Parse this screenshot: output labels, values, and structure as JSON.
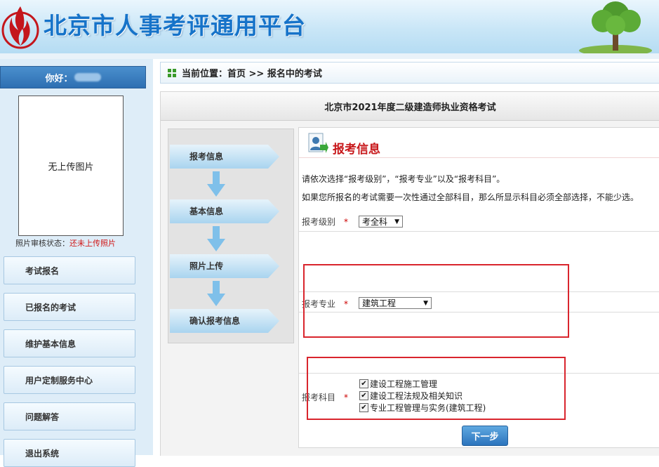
{
  "header": {
    "site_title": "北京市人事考评通用平台",
    "logo_icon": "flame-logo-icon",
    "decor_icon": "tree-icon"
  },
  "sidebar": {
    "greeting": "你好：",
    "photo_placeholder": "无上传图片",
    "photo_status_label": "照片审核状态：",
    "photo_status_value": "还未上传照片",
    "items": [
      {
        "label": "考试报名"
      },
      {
        "label": "已报名的考试"
      },
      {
        "label": "维护基本信息"
      },
      {
        "label": "用户定制服务中心"
      },
      {
        "label": "问题解答"
      },
      {
        "label": "退出系统"
      }
    ]
  },
  "breadcrumb": {
    "text": "当前位置：首页 >> 报名中的考试"
  },
  "exam": {
    "title": "北京市2021年度二级建造师执业资格考试"
  },
  "steps": [
    {
      "label": "报考信息"
    },
    {
      "label": "基本信息"
    },
    {
      "label": "照片上传"
    },
    {
      "label": "确认报考信息"
    }
  ],
  "form": {
    "section_title": "报考信息",
    "instruction_1": "请依次选择“报考级别”，“报考专业”以及“报考科目”。",
    "instruction_2": "如果您所报名的考试需要一次性通过全部科目，那么所显示科目必须全部选择，不能少选。",
    "level_label": "报考级别",
    "level_value": "考全科",
    "major_label": "报考专业",
    "major_value": "建筑工程",
    "subject_label": "报考科目",
    "required_mark": "*",
    "subjects": [
      {
        "label": "建设工程施工管理",
        "checked": true
      },
      {
        "label": "建设工程法规及相关知识",
        "checked": true
      },
      {
        "label": "专业工程管理与实务(建筑工程)",
        "checked": true
      }
    ],
    "next_label": "下一步"
  },
  "colors": {
    "accent_blue": "#1673c9",
    "section_red": "#c8181b",
    "highlight_red": "#d9252d"
  }
}
